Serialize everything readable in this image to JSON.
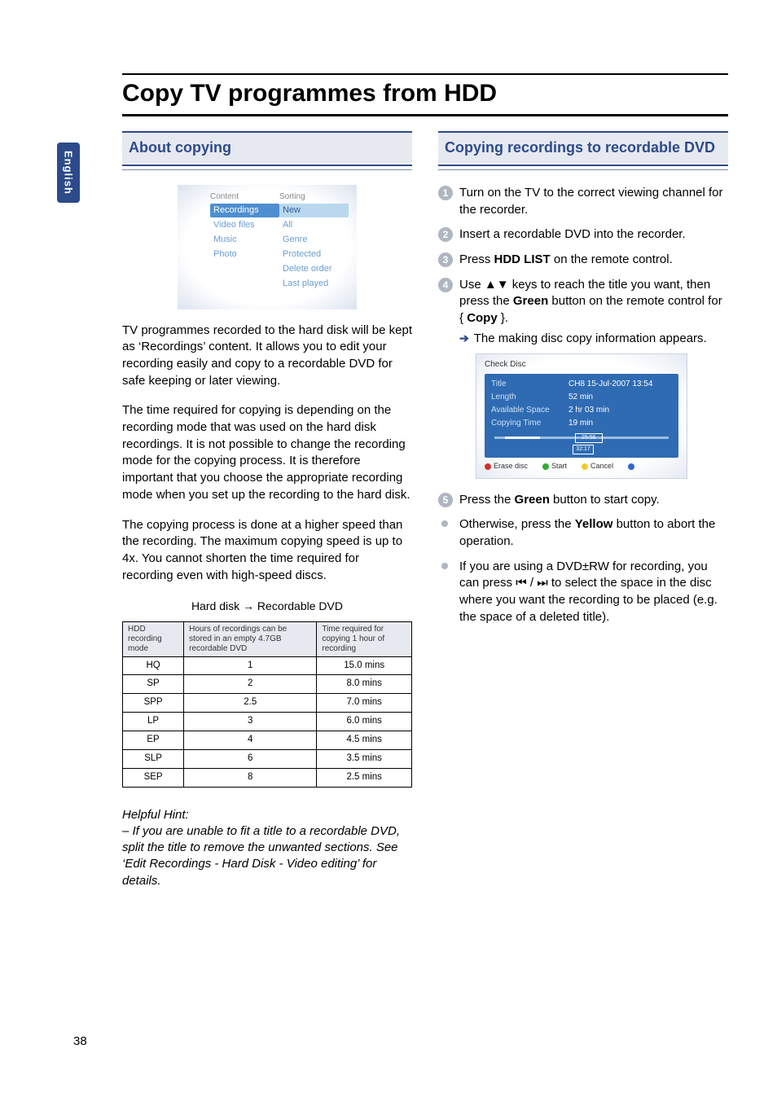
{
  "side_tab": "English",
  "page_title": "Copy TV programmes from HDD",
  "left": {
    "h2": "About copying",
    "content_box": {
      "head": {
        "a": "Content",
        "b": "Sorting"
      },
      "rows": [
        {
          "a": "Recordings",
          "b": "New",
          "selA": true,
          "selB": true
        },
        {
          "a": "Video files",
          "b": "All"
        },
        {
          "a": "Music",
          "b": "Genre"
        },
        {
          "a": "Photo",
          "b": "Protected"
        },
        {
          "a": "",
          "b": "Delete order"
        },
        {
          "a": "",
          "b": "Last played"
        }
      ]
    },
    "p1": "TV programmes recorded to the hard disk will be kept as ‘Recordings’ content. It allows you to edit your recording easily and copy to a recordable DVD for safe keeping or later viewing.",
    "p2": "The time required for copying is depending on the recording mode that was used on the hard disk recordings.  It is not possible to change the recording mode for the copying process. It is therefore important that you choose the appropriate recording mode when you set up the recording to the hard disk.",
    "p3": "The copying process is done at a higher speed than the recording. The maximum copying speed is up to 4x.  You cannot shorten the time required for recording even with high-speed discs.",
    "caption_a": "Hard disk",
    "caption_arrow": "→",
    "caption_b": "Recordable DVD",
    "table": {
      "head": {
        "c1": "HDD recording mode",
        "c2": "Hours of recordings can be stored in an empty 4.7GB recordable DVD",
        "c3": "Time required for copying 1 hour of recording"
      },
      "rows": [
        {
          "c1": "HQ",
          "c2": "1",
          "c3": "15.0 mins"
        },
        {
          "c1": "SP",
          "c2": "2",
          "c3": "8.0 mins"
        },
        {
          "c1": "SPP",
          "c2": "2.5",
          "c3": "7.0 mins"
        },
        {
          "c1": "LP",
          "c2": "3",
          "c3": "6.0 mins"
        },
        {
          "c1": "EP",
          "c2": "4",
          "c3": "4.5 mins"
        },
        {
          "c1": "SLP",
          "c2": "6",
          "c3": "3.5 mins"
        },
        {
          "c1": "SEP",
          "c2": "8",
          "c3": "2.5 mins"
        }
      ]
    },
    "hint_label": "Helpful Hint:",
    "hint_body": "– If you are unable to fit a title to a recordable DVD, split the title to remove the unwanted sections. See ‘Edit Recordings - Hard Disk - Video editing’ for details."
  },
  "right": {
    "h2": "Copying recordings to recordable DVD",
    "steps": {
      "s1": "Turn on the TV to the correct viewing channel for the recorder.",
      "s2": "Insert a recordable DVD into the recorder.",
      "s3_a": "Press ",
      "s3_b": "HDD LIST",
      "s3_c": " on the remote control.",
      "s4_a": "Use ",
      "s4_keys": "▲▼",
      "s4_b": " keys to reach the title you want, then press the ",
      "s4_c": "Green",
      "s4_d": " button on the remote control for { ",
      "s4_e": "Copy",
      "s4_f": " }.",
      "s4_sub": "The making disc copy information appears.",
      "s5_a": "Press the ",
      "s5_b": "Green",
      "s5_c": " button to start copy."
    },
    "check": {
      "title": "Check Disc",
      "rows": [
        {
          "lbl": "Title",
          "val": "CH8 15-Jul-2007 13:54"
        },
        {
          "lbl": "Length",
          "val": "52 min"
        },
        {
          "lbl": "Available Space",
          "val": "2 hr 03 min"
        },
        {
          "lbl": "Copying Time",
          "val": "19 min"
        }
      ],
      "marker": "25:56",
      "cap": "32:17",
      "legend": [
        {
          "color": "d-red",
          "label": "Erase disc"
        },
        {
          "color": "d-green",
          "label": "Start"
        },
        {
          "color": "d-yellow",
          "label": "Cancel"
        },
        {
          "color": "d-blue",
          "label": ""
        }
      ]
    },
    "bul1_a": "Otherwise, press the ",
    "bul1_b": "Yellow",
    "bul1_c": " button to abort the operation.",
    "bul2_a": "If you are using a DVD±RW for recording, you can press ",
    "bul2_keys": "⏮ / ⏭",
    "bul2_b": " to select the space in the disc where you want the recording to be placed (e.g. the space of a deleted title)."
  },
  "page_number": "38"
}
